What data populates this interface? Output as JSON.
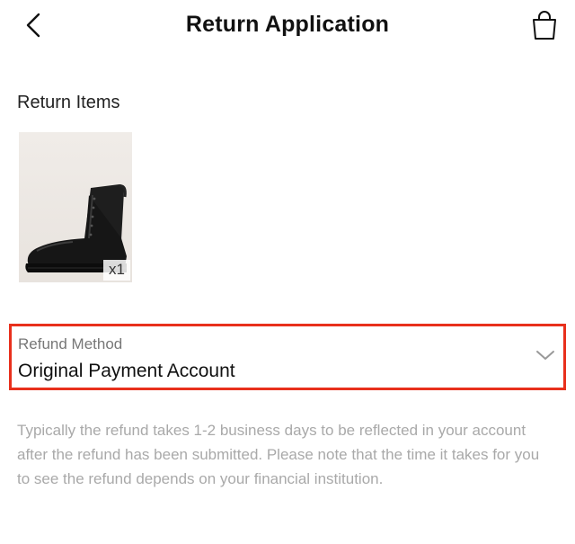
{
  "header": {
    "title": "Return Application",
    "back_icon": "chevron-left-icon",
    "bag_icon": "shopping-bag-icon"
  },
  "return_items": {
    "section_title": "Return Items",
    "items": [
      {
        "image": "black-combat-boot",
        "quantity": "x1"
      }
    ]
  },
  "refund_method": {
    "label": "Refund Method",
    "value": "Original Payment Account",
    "highlight_color": "#e8301c"
  },
  "note": "Typically the refund takes 1-2 business days to be reflected in your account after the refund has been submitted. Please note that the time it takes for you to see the refund depends on your financial institution."
}
